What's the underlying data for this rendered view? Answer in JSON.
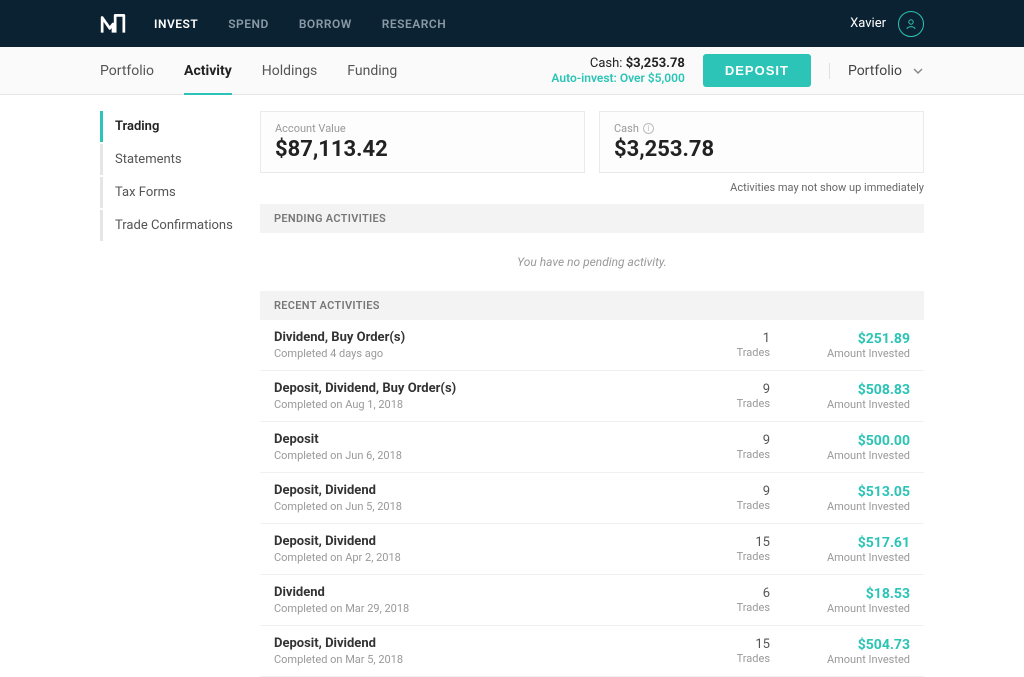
{
  "topbar": {
    "nav": [
      "INVEST",
      "SPEND",
      "BORROW",
      "RESEARCH"
    ],
    "activeIndex": 0,
    "username": "Xavier"
  },
  "subheader": {
    "tabs": [
      "Portfolio",
      "Activity",
      "Holdings",
      "Funding"
    ],
    "activeIndex": 1,
    "cash_label": "Cash:",
    "cash_value": "$3,253.78",
    "autoinvest_label": "Auto-invest:",
    "autoinvest_value": "Over $5,000",
    "deposit_label": "DEPOSIT",
    "selector_label": "Portfolio"
  },
  "sidebar": {
    "items": [
      "Trading",
      "Statements",
      "Tax Forms",
      "Trade Confirmations"
    ],
    "activeIndex": 0
  },
  "cards": {
    "account_value_label": "Account Value",
    "account_value": "$87,113.42",
    "cash_label": "Cash",
    "cash_value": "$3,253.78"
  },
  "notice": "Activities may not show up immediately",
  "pending": {
    "header": "PENDING ACTIVITIES",
    "empty": "You have no pending activity."
  },
  "recent": {
    "header": "RECENT ACTIVITIES",
    "trades_label": "Trades",
    "amount_label": "Amount Invested",
    "rows": [
      {
        "title": "Dividend, Buy Order(s)",
        "sub": "Completed 4 days ago",
        "count": "1",
        "amount": "$251.89"
      },
      {
        "title": "Deposit, Dividend, Buy Order(s)",
        "sub": "Completed on Aug 1, 2018",
        "count": "9",
        "amount": "$508.83"
      },
      {
        "title": "Deposit",
        "sub": "Completed on Jun 6, 2018",
        "count": "9",
        "amount": "$500.00"
      },
      {
        "title": "Deposit, Dividend",
        "sub": "Completed on Jun 5, 2018",
        "count": "9",
        "amount": "$513.05"
      },
      {
        "title": "Deposit, Dividend",
        "sub": "Completed on Apr 2, 2018",
        "count": "15",
        "amount": "$517.61"
      },
      {
        "title": "Dividend",
        "sub": "Completed on Mar 29, 2018",
        "count": "6",
        "amount": "$18.53"
      },
      {
        "title": "Deposit, Dividend",
        "sub": "Completed on Mar 5, 2018",
        "count": "15",
        "amount": "$504.73"
      }
    ]
  }
}
